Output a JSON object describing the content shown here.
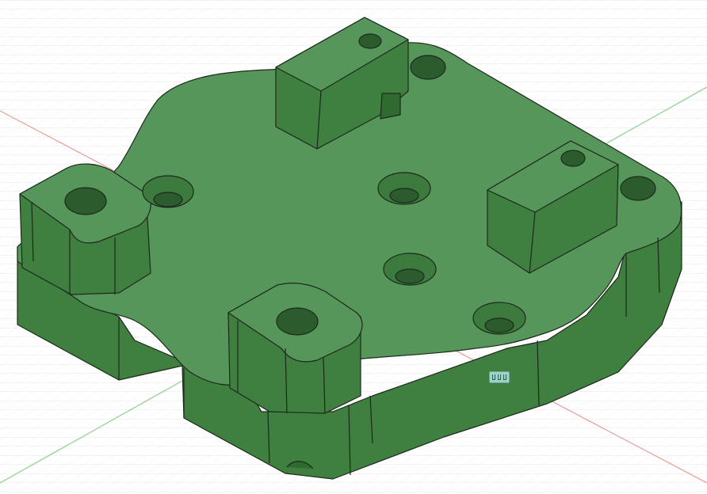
{
  "viewport": {
    "background": "#ffffff",
    "grid_minor_color": "#e3e3e3",
    "grid_major_color": "#cfcfcf",
    "axis_x_color": "#e79a9a",
    "axis_y_color": "#8fd08f"
  },
  "model": {
    "body_top_color": "#57965a",
    "body_side_color": "#3f7f3f",
    "body_dark_color": "#2f6a30",
    "edge_color": "#1c2a1c",
    "hole_color": "#2c5c2d",
    "hole_inner_color": "#6aa46c"
  },
  "status_chip": {
    "icon": "fillet-feature-icon",
    "color": "#9fd3c8"
  }
}
